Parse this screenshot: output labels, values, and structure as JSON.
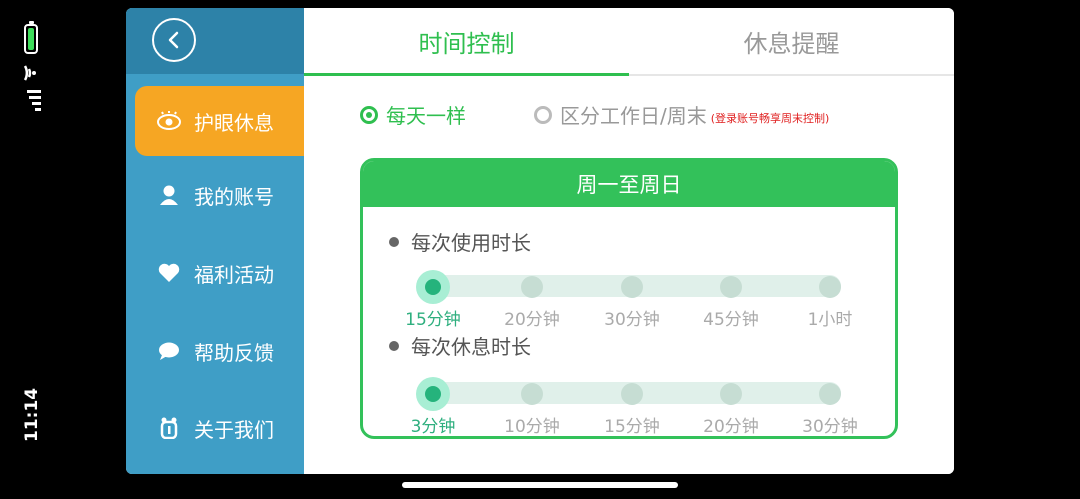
{
  "status": {
    "time": "11:14"
  },
  "sidebar": {
    "items": [
      {
        "label": "护眼休息",
        "icon": "eye-icon",
        "active": true
      },
      {
        "label": "我的账号",
        "icon": "user-icon",
        "active": false
      },
      {
        "label": "福利活动",
        "icon": "heart-icon",
        "active": false
      },
      {
        "label": "帮助反馈",
        "icon": "chat-icon",
        "active": false
      },
      {
        "label": "关于我们",
        "icon": "info-icon",
        "active": false
      }
    ]
  },
  "tabs": [
    {
      "label": "时间控制",
      "active": true
    },
    {
      "label": "休息提醒",
      "active": false
    }
  ],
  "mode": {
    "option1": "每天一样",
    "option2": "区分工作日/周末",
    "note": "(登录账号畅享周末控制)",
    "selected": "每天一样"
  },
  "card": {
    "title": "周一至周日",
    "usage": {
      "label": "每次使用时长",
      "stops": [
        "15分钟",
        "20分钟",
        "30分钟",
        "45分钟",
        "1小时"
      ],
      "selected": "15分钟"
    },
    "rest": {
      "label": "每次休息时长",
      "stops": [
        "3分钟",
        "10分钟",
        "15分钟",
        "20分钟",
        "30分钟"
      ],
      "selected": "3分钟"
    }
  },
  "colors": {
    "accent": "#2fbf4f",
    "sidebar": "#3f9ec6",
    "active_nav": "#f6a623",
    "note": "#e02020"
  }
}
